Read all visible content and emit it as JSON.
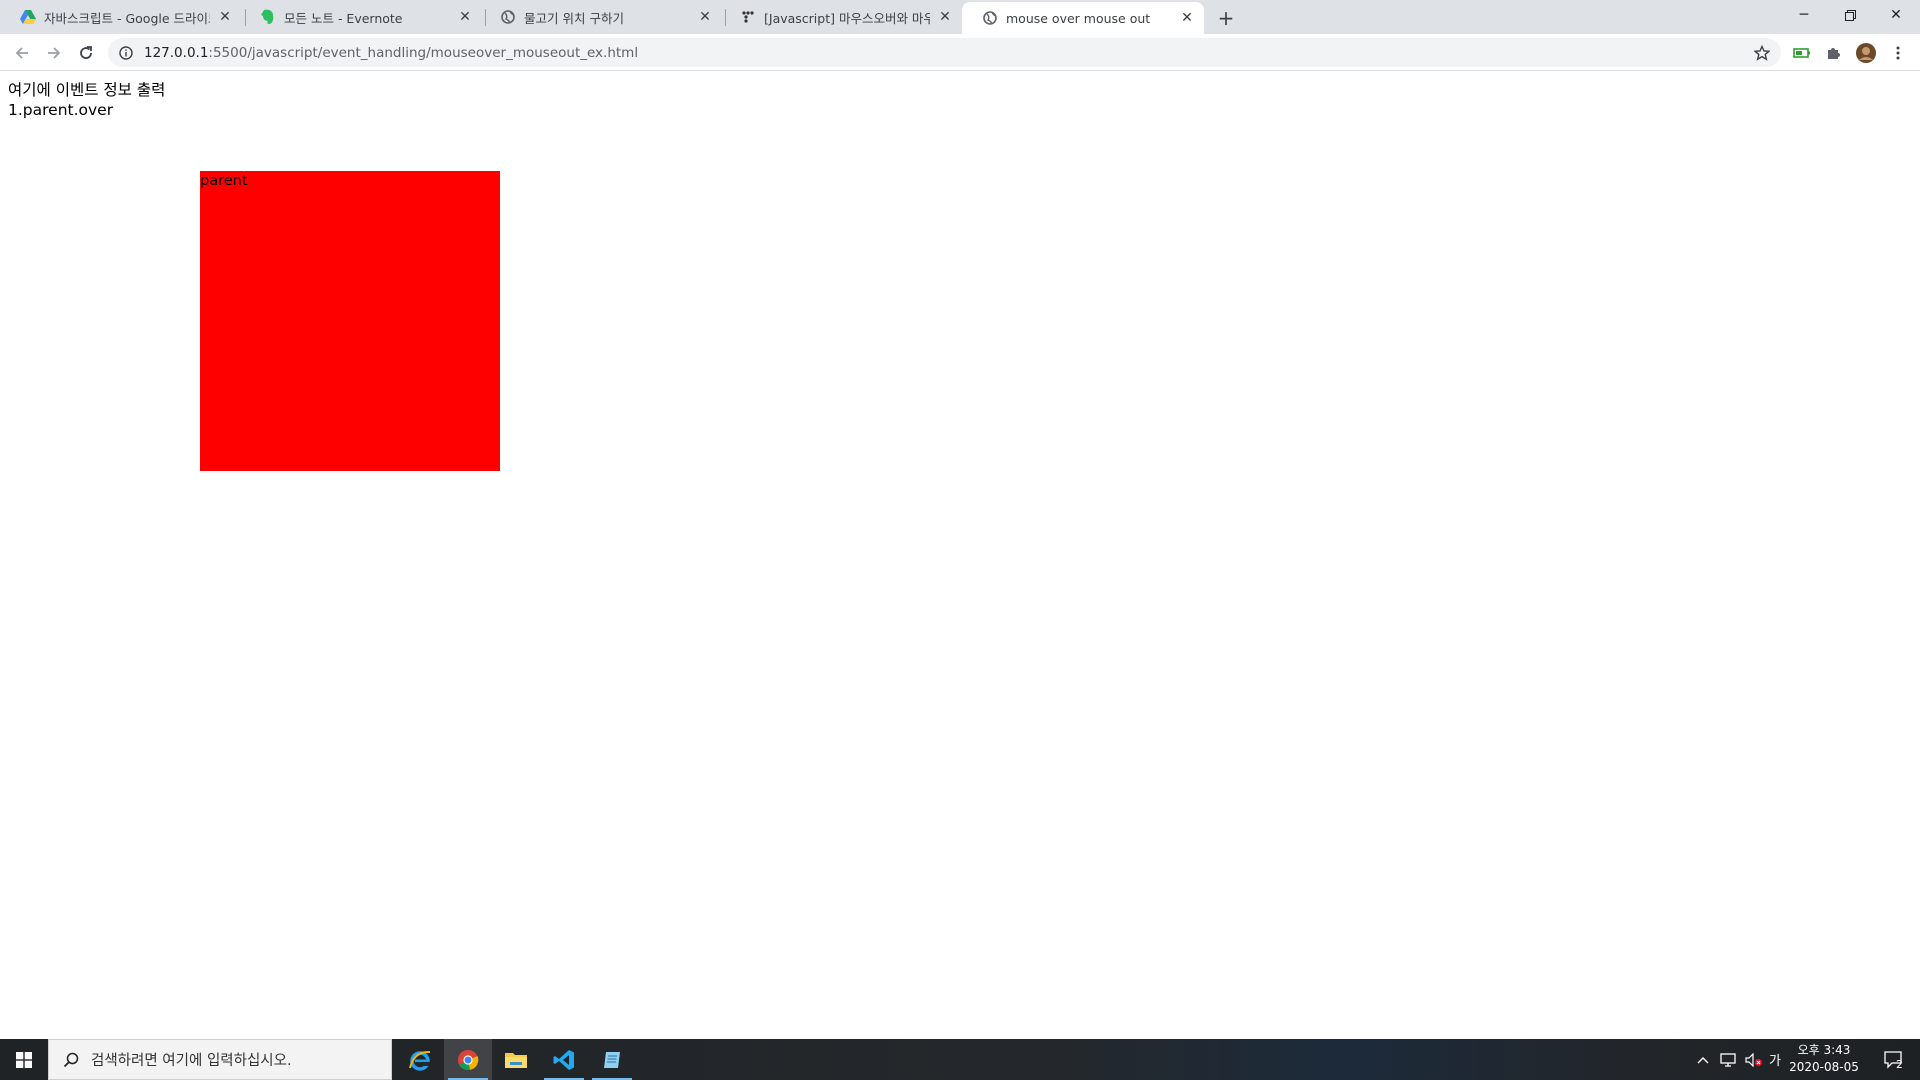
{
  "browser": {
    "tabs": [
      {
        "title": "자바스크립트 - Google 드라이브",
        "favicon": "google-drive-icon",
        "active": false
      },
      {
        "title": "모든 노트 - Evernote",
        "favicon": "evernote-icon",
        "active": false
      },
      {
        "title": "물고기 위치 구하기",
        "favicon": "globe-icon",
        "active": false
      },
      {
        "title": "[Javascript] 마우스오버와 마우스아웃",
        "favicon": "dots-icon",
        "active": false
      },
      {
        "title": "mouse over mouse out",
        "favicon": "globe-icon",
        "active": true
      }
    ],
    "address": {
      "host": "127.0.0.1",
      "path": ":5500/javascript/event_handling/mouseover_mouseout_ex.html"
    }
  },
  "page": {
    "info_heading": "여기에 이벤트 정보 출력",
    "event_log": [
      "1.parent.over"
    ],
    "parent_label": "parent",
    "parent_color": "#ff0000"
  },
  "taskbar": {
    "search_placeholder": "검색하려면 여기에 입력하십시오.",
    "ime_label": "가",
    "clock_time": "오후 3:43",
    "clock_date": "2020-08-05",
    "notification_count": "2"
  }
}
